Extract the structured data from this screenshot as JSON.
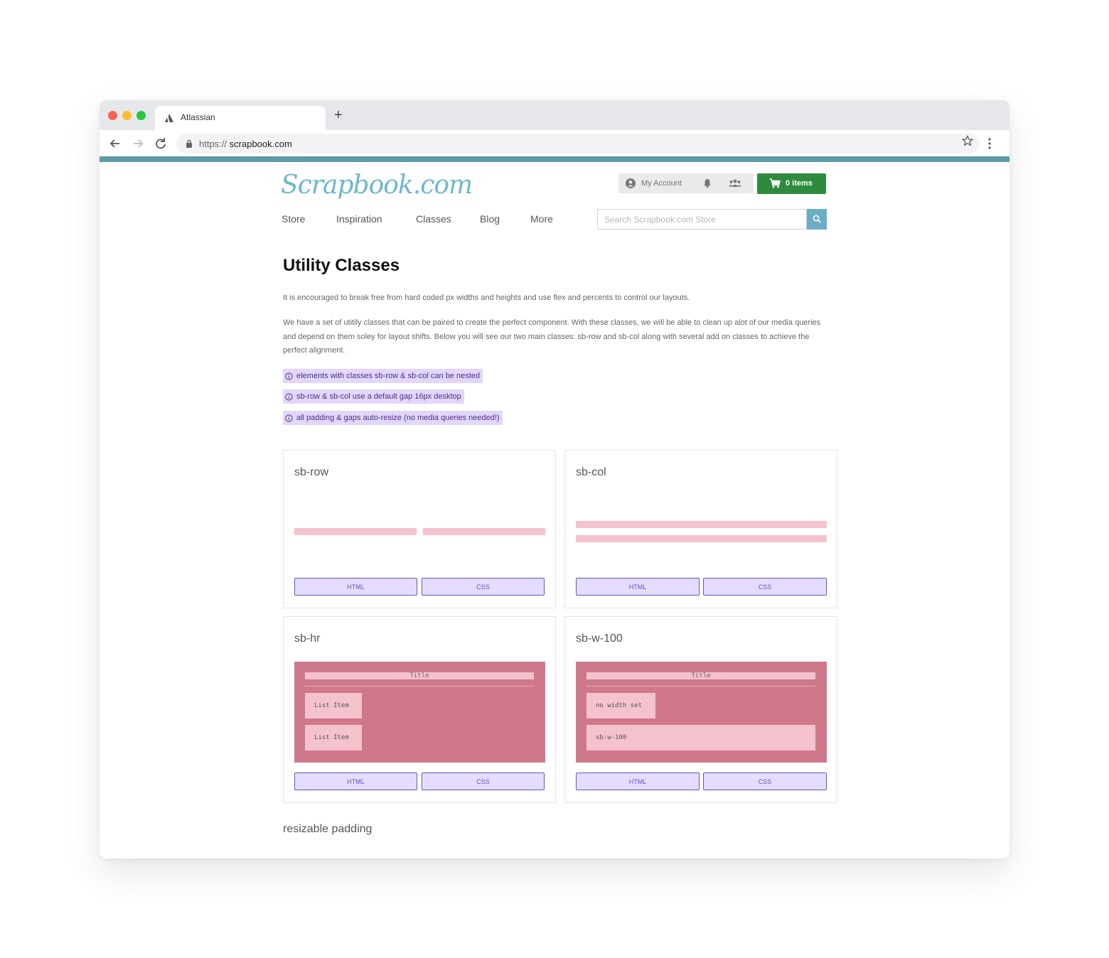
{
  "browser": {
    "tab_title": "Atlassian",
    "url_scheme": "https://",
    "url_host": "scrapbook.com"
  },
  "site": {
    "logo": "Scrapbook.com",
    "account_label": "My Account",
    "cart_label": "0 items",
    "nav": [
      "Store",
      "Inspiration",
      "Classes",
      "Blog",
      "More"
    ],
    "search_placeholder": "Search Scrapbook.com Store",
    "accent_color": "#5f9aa8",
    "cart_color": "#2e8b3e"
  },
  "page": {
    "title": "Utility Classes",
    "intro": "It is encouraged to break free from hard coded px widths and heights and use flex and percents to control our layouts.",
    "body": "We have a set of utitily classes that can be paired to create the perfect component. With these classes, we will be able to clean up alot of our media queries and depend on them soley for layout shifts. Below you will see our two main classes: sb-row and sb-col along with several add on classes to achieve the perfect alignment.",
    "notes": [
      "elements with classes sb-row & sb-col can be nested",
      "sb-row & sb-col use a default gap 16px desktop",
      "all padding & gaps auto-resize (no media queries needed!)"
    ],
    "cards": [
      {
        "title": "sb-row",
        "html_label": "HTML",
        "css_label": "CSS"
      },
      {
        "title": "sb-col",
        "html_label": "HTML",
        "css_label": "CSS"
      },
      {
        "title": "sb-hr",
        "html_label": "HTML",
        "css_label": "CSS",
        "demo_title": "Title",
        "items": [
          "List Item",
          "List Item"
        ]
      },
      {
        "title": "sb-w-100",
        "html_label": "HTML",
        "css_label": "CSS",
        "demo_title": "Title",
        "items": [
          "no width set",
          "sb-w-100"
        ]
      }
    ],
    "next_section": "resizable padding"
  }
}
